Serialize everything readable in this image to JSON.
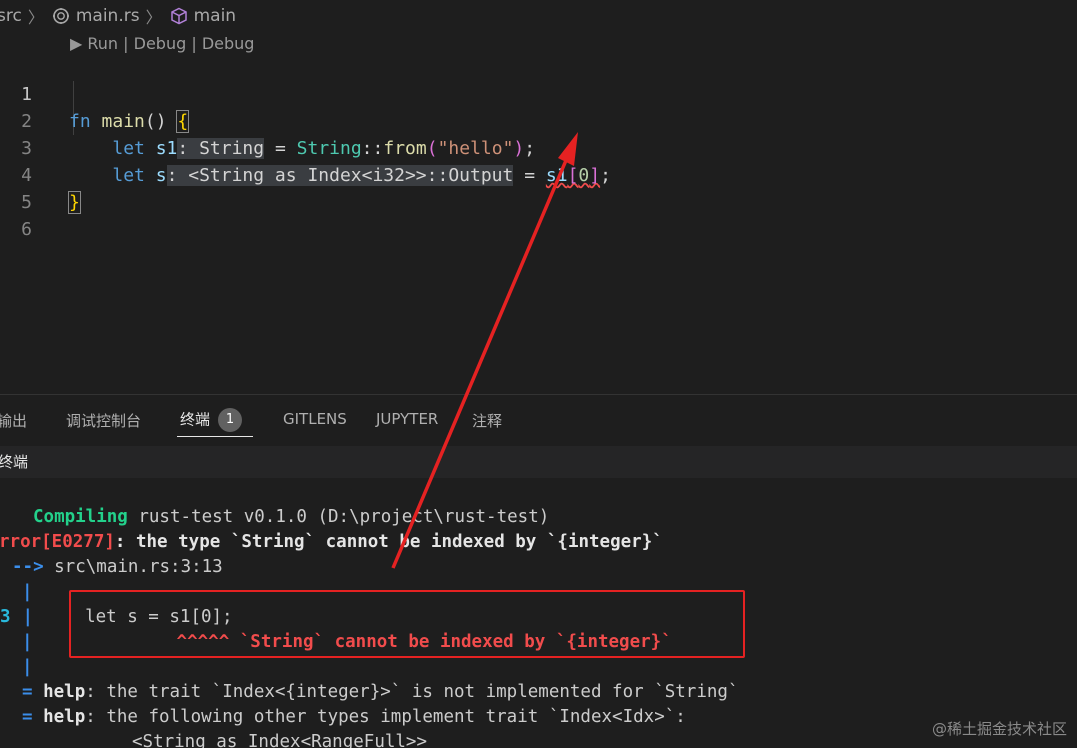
{
  "breadcrumb": {
    "items": [
      "src",
      "main.rs",
      "main"
    ],
    "sep": "〉"
  },
  "codelens": {
    "text": "▶ Run | Debug | Debug"
  },
  "editor": {
    "line_numbers": [
      "1",
      "2",
      "3",
      "4",
      "5",
      "6"
    ],
    "line1": {
      "kw": "fn",
      "name": "main",
      "parens": "()",
      "brace": "{"
    },
    "line2": {
      "kw": "let",
      "var": "s1",
      "hint": ": String",
      "eq": "=",
      "ty": "String",
      "path": "::",
      "fn": "from",
      "paren_open": "(",
      "str": "\"hello\"",
      "paren_close": ")",
      "semi": ";"
    },
    "line3": {
      "kw": "let",
      "var": "s",
      "hint": ": <String as Index<i32>>::Output",
      "eq": "=",
      "var2": "s1",
      "bracket_open": "[",
      "num": "0",
      "bracket_close": "]",
      "semi": ";"
    },
    "line4": {
      "brace": "}"
    }
  },
  "panel": {
    "tabs": [
      "输出",
      "调试控制台",
      "终端",
      "GITLENS",
      "JUPYTER",
      "注释"
    ],
    "active_tab": "终端",
    "badge": "1",
    "terminal_title": "终端"
  },
  "terminal": {
    "l1_green": "Compiling",
    "l1_rest": " rust-test v0.1.0 (D:\\project\\rust-test)",
    "l2_red": "rror[E0277]",
    "l2_white": ": the type `String` cannot be indexed by `{integer}`",
    "l3_arrow": "-->",
    "l3_rest": " src\\main.rs:3:13",
    "l4_pipe": "|",
    "l5_num": "3",
    "l5_pipe": "|",
    "l5_code": "let s = s1[0];",
    "l6_pipe": "|",
    "l6_red": "^^^^^ `String` cannot be indexed by `{integer}`",
    "l7_pipe": "|",
    "l8_eq": "=",
    "l8_help": "help",
    "l8_rest": ": the trait `Index<{integer}>` is not implemented for `String`",
    "l9_eq": "=",
    "l9_help": "help",
    "l9_rest": ": the following other types implement trait `Index<Idx>`:",
    "l10": "<String as Index<RangeFull>>"
  },
  "watermark": "@稀土掘金技术社区",
  "colors": {
    "annotation_red": "#e52222",
    "editor_bg": "#1e1e1e",
    "keyword": "#569cd6",
    "type": "#4ec9b0",
    "error": "#f14c4c",
    "success": "#23d18b"
  }
}
